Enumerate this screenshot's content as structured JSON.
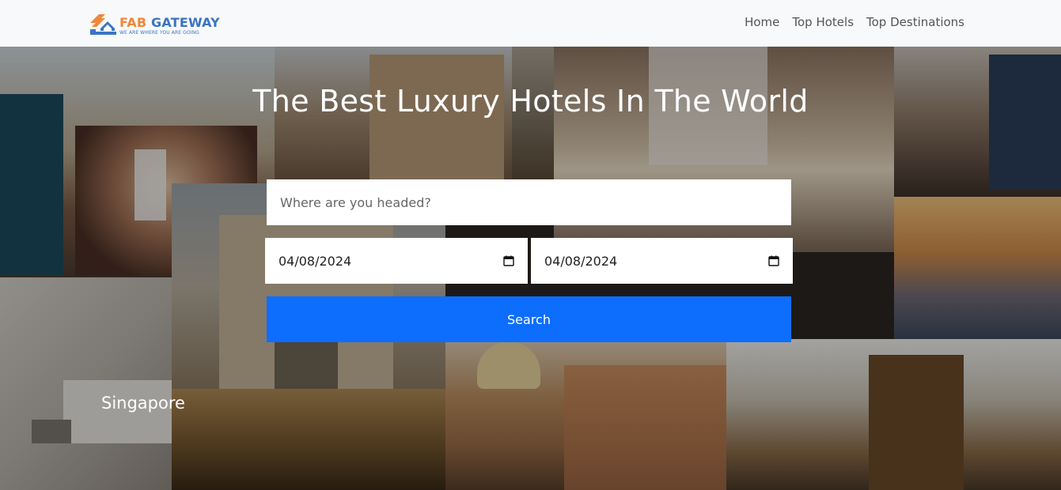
{
  "brand": {
    "name_part1": "FAB",
    "name_part2": " GATEWAY",
    "tagline": "WE ARE WHERE YOU ARE GOING",
    "logo_icon": "house-arrows-icon",
    "colors": {
      "orange": "#f0873a",
      "blue": "#3a74c4"
    }
  },
  "nav": {
    "links": [
      {
        "label": "Home"
      },
      {
        "label": "Top Hotels"
      },
      {
        "label": "Top Destinations"
      }
    ]
  },
  "hero": {
    "headline": "The Best Luxury Hotels In The World",
    "caption": "Singapore"
  },
  "search_form": {
    "destination_placeholder": "Where are you headed?",
    "checkin_value": "04/08/2024",
    "checkout_value": "04/08/2024",
    "calendar_icon": "calendar-icon",
    "submit_label": "Search",
    "accent_color": "#0d6efd"
  }
}
